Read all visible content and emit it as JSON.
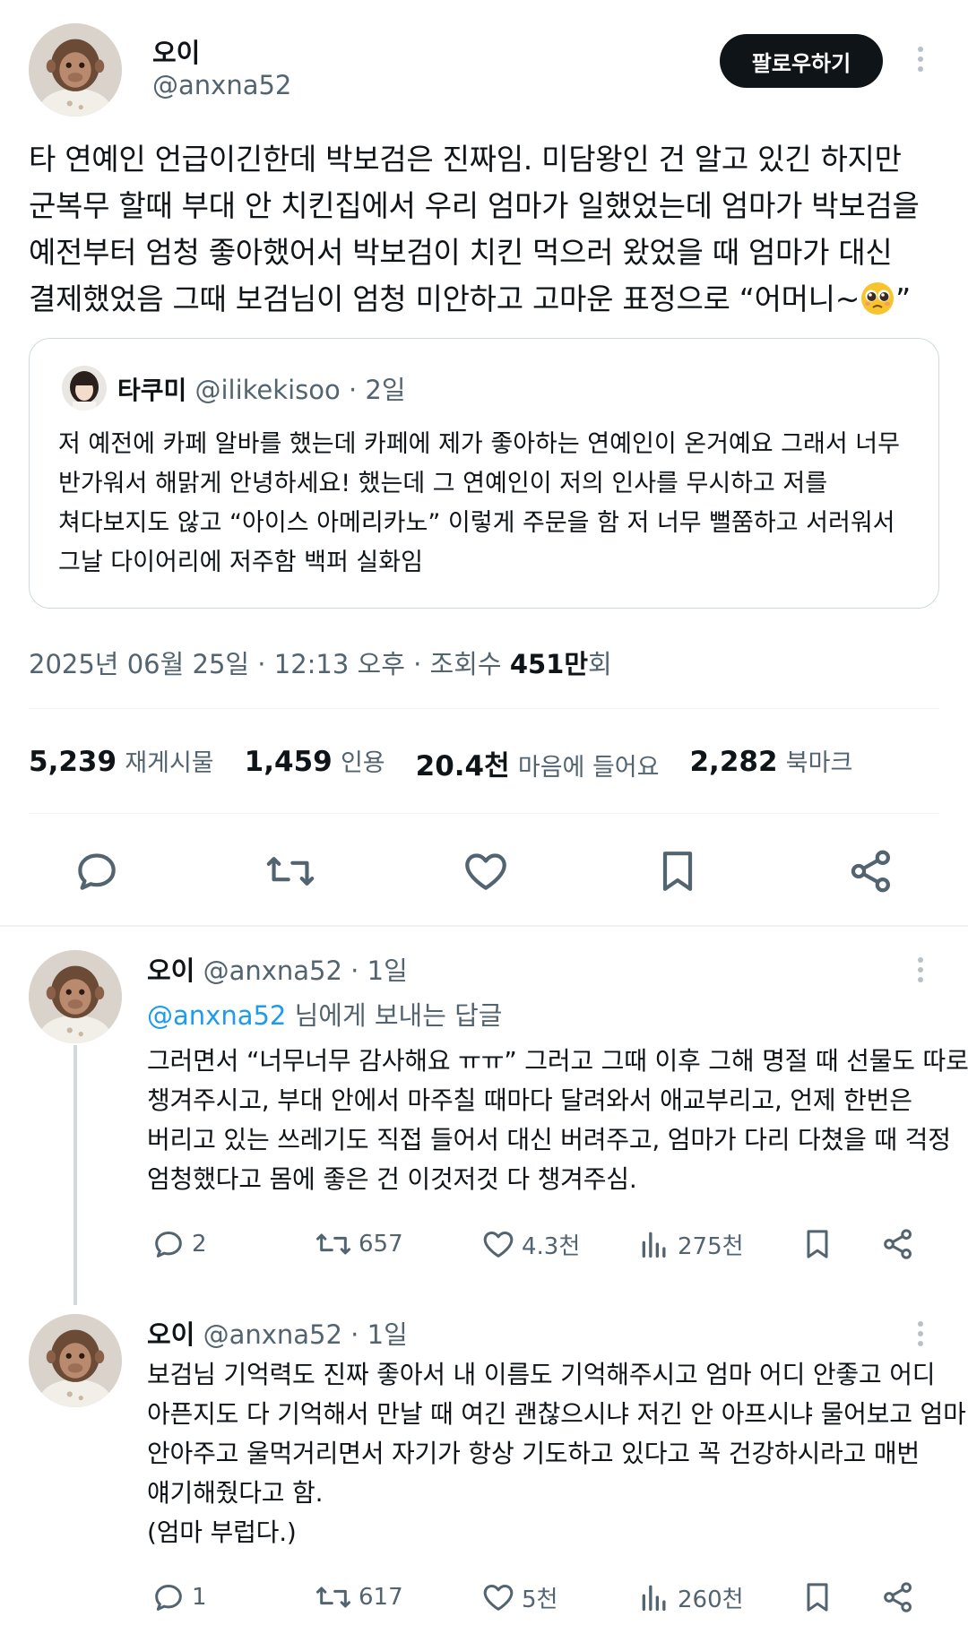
{
  "tweet": {
    "author_name": "오이",
    "author_handle": "@anxna52",
    "follow_label": "팔로우하기",
    "text_lines": [
      "타 연예인 언급이긴한데 박보검은 진짜임. 미담왕인 건 알고 있긴 하지만",
      "군복무 할때 부대 안 치킨집에서 우리 엄마가 일했었는데 엄마가 박보검을",
      "예전부터 엄청 좋아했어서 박보검이 치킨 먹으러 왔었을 때 엄마가 대신",
      "결제했었음 그때 보검님이 엄청 미안하고 고마운 표정으로 “어머니~",
      "”"
    ],
    "emoji": "pleading-face"
  },
  "quote": {
    "name": "타쿠미",
    "handle": "@ilikekisoo",
    "time": "· 2일",
    "text_lines": [
      "저 예전에 카페 알바를 했는데 카페에 제가 좋아하는 연예인이 온거예요 그래서 너무",
      "반가워서 해맑게 안녕하세요! 했는데 그 연예인이 저의 인사를 무시하고 저를",
      "쳐다보지도 않고 “아이스 아메리카노” 이렇게 주문을 함 저 너무 뻘쭘하고 서러워서",
      "그날 다이어리에 저주함 백퍼 실화임"
    ]
  },
  "meta": {
    "timestamp": "2025년 06월 25일 · 12:13 오후 · 조회수 ",
    "views_num": "451만",
    "views_suffix": "회"
  },
  "stats": {
    "retweets_num": "5,239",
    "retweets_label": "재게시물",
    "quotes_num": "1,459",
    "quotes_label": "인용",
    "likes_num": "20.4천",
    "likes_label": "마음에 들어요",
    "bookmarks_num": "2,282",
    "bookmarks_label": "북마크"
  },
  "replies": [
    {
      "name": "오이",
      "handle_time": "@anxna52 · 1일",
      "replying_mention": "@anxna52",
      "replying_suffix": " 님에게 보내는 답글",
      "text_lines": [
        "그러면서 “너무너무 감사해요 ㅠㅠ” 그러고 그때 이후 그해 명절 때 선물도 따로",
        "챙겨주시고, 부대 안에서 마주칠 때마다 달려와서 애교부리고, 언제 한번은",
        "버리고 있는 쓰레기도 직접 들어서 대신 버려주고, 엄마가 다리 다쳤을 때 걱정",
        "엄청했다고 몸에 좋은 건 이것저것 다 챙겨주심."
      ],
      "replies_count": "2",
      "retweets_count": "657",
      "likes_count": "4.3천",
      "views_count": "275천"
    },
    {
      "name": "오이",
      "handle_time": "@anxna52 · 1일",
      "text_lines": [
        "보검님 기억력도 진짜 좋아서 내 이름도 기억해주시고 엄마 어디 안좋고 어디",
        "아픈지도 다 기억해서 만날 때 여긴 괜찮으시냐 저긴 안 아프시냐 물어보고 엄마",
        "안아주고 울먹거리면서 자기가 항상 기도하고 있다고 꼭 건강하시라고 매번",
        "얘기해줬다고 함.",
        "(엄마 부럽다.)"
      ],
      "replies_count": "1",
      "retweets_count": "617",
      "likes_count": "5천",
      "views_count": "260천"
    }
  ],
  "colors": {
    "text": "#0f1419",
    "secondary": "#536471",
    "link": "#1d9bf0",
    "border": "#cfd9de",
    "divider": "#eff3f4"
  }
}
